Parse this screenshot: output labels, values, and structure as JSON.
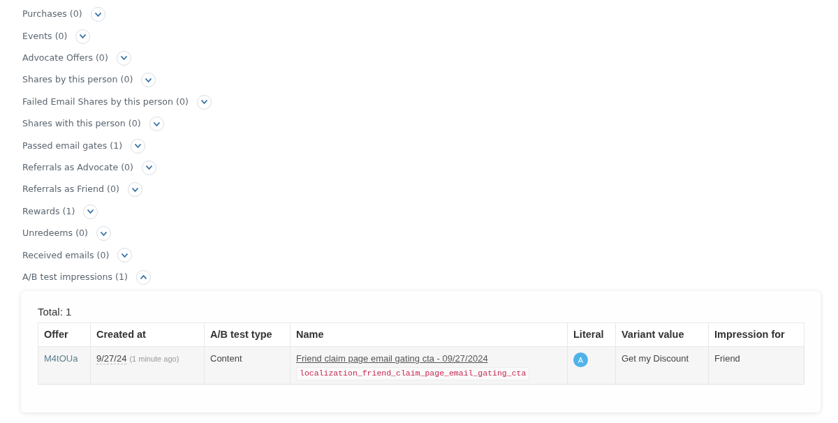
{
  "sections": [
    {
      "label": "Purchases (0)",
      "expanded": false
    },
    {
      "label": "Events (0)",
      "expanded": false
    },
    {
      "label": "Advocate Offers (0)",
      "expanded": false
    },
    {
      "label": "Shares by this person (0)",
      "expanded": false
    },
    {
      "label": "Failed Email Shares by this person (0)",
      "expanded": false
    },
    {
      "label": "Shares with this person (0)",
      "expanded": false
    },
    {
      "label": "Passed email gates (1)",
      "expanded": false
    },
    {
      "label": "Referrals as Advocate (0)",
      "expanded": false
    },
    {
      "label": "Referrals as Friend (0)",
      "expanded": false
    },
    {
      "label": "Rewards (1)",
      "expanded": false
    },
    {
      "label": "Unredeems (0)",
      "expanded": false
    },
    {
      "label": "Received emails (0)",
      "expanded": false
    },
    {
      "label": "A/B test impressions (1)",
      "expanded": true
    }
  ],
  "panel": {
    "total": "Total: 1",
    "table": {
      "columns": [
        "Offer",
        "Created at",
        "A/B test type",
        "Name",
        "Literal",
        "Variant value",
        "Impression for"
      ],
      "rows": [
        {
          "offer": "M4tOUa",
          "created_date": "9/27/24",
          "created_relative": "(1 minute ago)",
          "ab_test_type": "Content",
          "name": "Friend claim page email gating cta - 09/27/2024",
          "key": "localization_friend_claim_page_email_gating_cta",
          "literal": "A",
          "variant_value": "Get my Discount",
          "impression_for": "Friend"
        }
      ]
    }
  }
}
